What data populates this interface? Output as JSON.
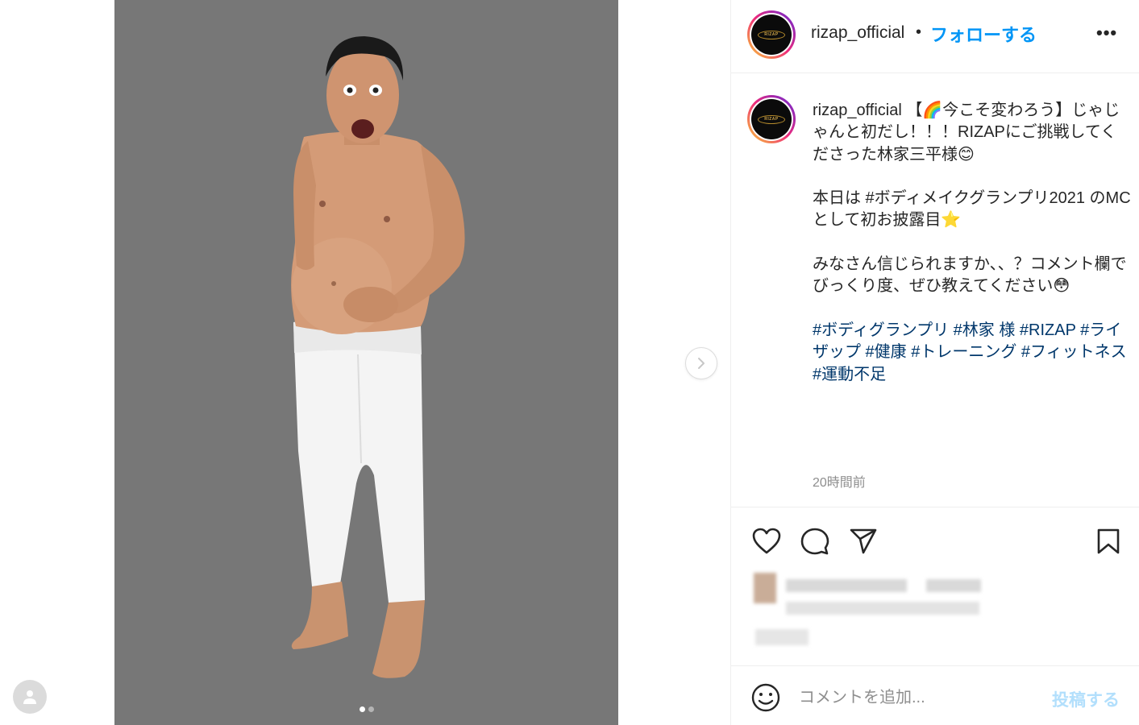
{
  "post": {
    "username": "rizap_official",
    "separator": "•",
    "follow_label": "フォローする",
    "more_label": "•••",
    "avatar_logo_text": "RIZAP",
    "image_dots": 2,
    "active_dot": 0
  },
  "caption": {
    "username": "rizap_official",
    "paragraphs": [
      "【🌈今こそ変わろう】じゃじゃんと初だし！！！RIZAPにご挑戦してくださった林家三平様😊",
      "本日は #ボディメイクグランプリ2021 のMCとして初お披露目⭐",
      "みなさん信じられますか、、？コメント欄でびっくり度、ぜひ教えてください😳",
      "#ボディグランプリ #林家 様 #RIZAP #ライザップ #健康 #トレーニング #フィットネス #運動不足"
    ],
    "timestamp": "20時間前"
  },
  "comment": {
    "placeholder": "コメントを追加...",
    "post_label": "投稿する"
  },
  "colors": {
    "link_blue": "#0095f6",
    "hashtag": "#00376b",
    "photo_bg": "#777777",
    "muted_text": "#8e8e8e",
    "post_disabled": "#b2dffc"
  },
  "icons": [
    "heart-icon",
    "comment-icon",
    "share-icon",
    "bookmark-icon",
    "chevron-right-icon",
    "emoji-icon",
    "user-icon"
  ]
}
